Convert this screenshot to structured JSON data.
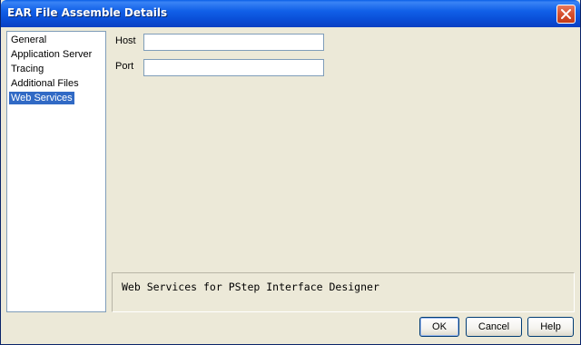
{
  "window": {
    "title": "EAR File Assemble Details"
  },
  "nav": {
    "items": [
      {
        "label": "General",
        "selected": false
      },
      {
        "label": "Application Server",
        "selected": false
      },
      {
        "label": "Tracing",
        "selected": false
      },
      {
        "label": "Additional Files",
        "selected": false
      },
      {
        "label": "Web Services",
        "selected": true
      }
    ]
  },
  "form": {
    "host_label": "Host",
    "host_value": "",
    "port_label": "Port",
    "port_value": ""
  },
  "description": {
    "text": "Web Services for PStep Interface Designer"
  },
  "buttons": {
    "ok": "OK",
    "cancel": "Cancel",
    "help": "Help"
  },
  "colors": {
    "titlebar": "#0a4fd8",
    "selection": "#316ac5",
    "dialog_bg": "#ece9d8"
  }
}
